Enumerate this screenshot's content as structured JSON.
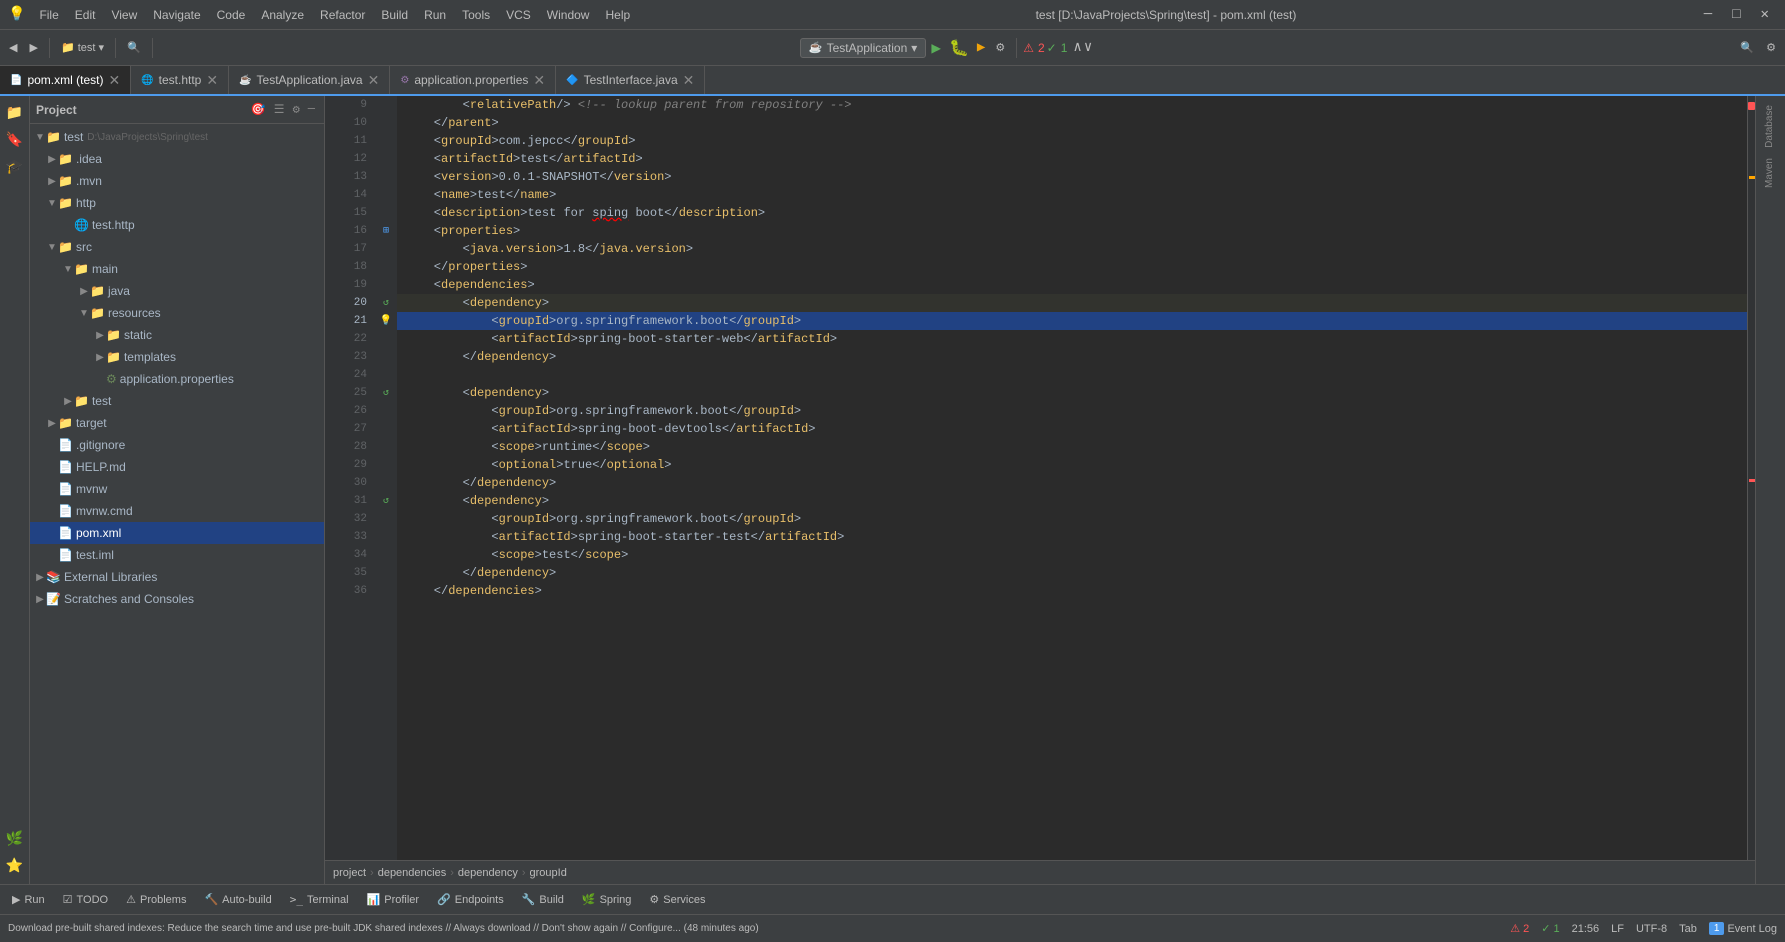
{
  "window": {
    "title": "test [D:\\JavaProjects\\Spring\\test] - pom.xml (test)",
    "app_icon": "💡"
  },
  "menus": [
    "File",
    "Edit",
    "View",
    "Navigate",
    "Code",
    "Analyze",
    "Refactor",
    "Build",
    "Run",
    "Tools",
    "VCS",
    "Window",
    "Help"
  ],
  "project_tab": "Project",
  "run_config": "TestApplication",
  "tabs": [
    {
      "id": "pom-xml",
      "label": "pom.xml (test)",
      "icon": "📄",
      "active": true,
      "closable": true
    },
    {
      "id": "test-http",
      "label": "test.http",
      "icon": "🌐",
      "active": false,
      "closable": true
    },
    {
      "id": "TestApplication",
      "label": "TestApplication.java",
      "icon": "☕",
      "active": false,
      "closable": true
    },
    {
      "id": "app-props",
      "label": "application.properties",
      "icon": "⚙",
      "active": false,
      "closable": true
    },
    {
      "id": "TestInterface",
      "label": "TestInterface.java",
      "icon": "🔷",
      "active": false,
      "closable": true
    }
  ],
  "tree": {
    "root": "test",
    "root_path": "D:\\JavaProjects\\Spring\\test",
    "items": [
      {
        "id": "idea",
        "name": ".idea",
        "type": "folder",
        "indent": 1,
        "expanded": false
      },
      {
        "id": "mvn",
        "name": ".mvn",
        "type": "folder",
        "indent": 1,
        "expanded": false
      },
      {
        "id": "http",
        "name": "http",
        "type": "folder",
        "indent": 1,
        "expanded": true
      },
      {
        "id": "test-http-file",
        "name": "test.http",
        "type": "http",
        "indent": 2,
        "expanded": false
      },
      {
        "id": "src",
        "name": "src",
        "type": "folder",
        "indent": 1,
        "expanded": true
      },
      {
        "id": "main",
        "name": "main",
        "type": "folder",
        "indent": 2,
        "expanded": true
      },
      {
        "id": "java",
        "name": "java",
        "type": "folder",
        "indent": 3,
        "expanded": false
      },
      {
        "id": "resources",
        "name": "resources",
        "type": "folder",
        "indent": 3,
        "expanded": true
      },
      {
        "id": "static",
        "name": "static",
        "type": "folder",
        "indent": 4,
        "expanded": false
      },
      {
        "id": "templates",
        "name": "templates",
        "type": "folder",
        "indent": 4,
        "expanded": false
      },
      {
        "id": "app-props-file",
        "name": "application.properties",
        "type": "props",
        "indent": 4,
        "expanded": false
      },
      {
        "id": "test-folder",
        "name": "test",
        "type": "folder",
        "indent": 2,
        "expanded": false
      },
      {
        "id": "target",
        "name": "target",
        "type": "folder",
        "indent": 1,
        "expanded": false
      },
      {
        "id": "gitignore",
        "name": ".gitignore",
        "type": "file",
        "indent": 1,
        "expanded": false
      },
      {
        "id": "helpmd",
        "name": "HELP.md",
        "type": "file",
        "indent": 1,
        "expanded": false
      },
      {
        "id": "mvnw-file",
        "name": "mvnw",
        "type": "file",
        "indent": 1,
        "expanded": false
      },
      {
        "id": "mvnw-cmd",
        "name": "mvnw.cmd",
        "type": "file",
        "indent": 1,
        "expanded": false
      },
      {
        "id": "pom-xml-file",
        "name": "pom.xml",
        "type": "xml",
        "indent": 1,
        "expanded": false,
        "selected": true
      },
      {
        "id": "test-iml",
        "name": "test.iml",
        "type": "file",
        "indent": 1,
        "expanded": false
      },
      {
        "id": "ext-libs",
        "name": "External Libraries",
        "type": "ext",
        "indent": 0,
        "expanded": false
      },
      {
        "id": "scratches",
        "name": "Scratches and Consoles",
        "type": "scratch",
        "indent": 0,
        "expanded": false
      }
    ]
  },
  "code": {
    "lines": [
      {
        "num": 9,
        "content": "        <relativePath/> <!-- lookup parent from repository -->",
        "type": "normal"
      },
      {
        "num": 10,
        "content": "    </parent>",
        "type": "normal"
      },
      {
        "num": 11,
        "content": "    <groupId>com.jepcc</groupId>",
        "type": "normal"
      },
      {
        "num": 12,
        "content": "    <artifactId>test</artifactId>",
        "type": "normal"
      },
      {
        "num": 13,
        "content": "    <version>0.0.1-SNAPSHOT</version>",
        "type": "normal"
      },
      {
        "num": 14,
        "content": "    <name>test</name>",
        "type": "normal"
      },
      {
        "num": 15,
        "content": "    <description>test for sping boot</description>",
        "type": "normal",
        "has_typo": true
      },
      {
        "num": 16,
        "content": "    <properties>",
        "type": "fold"
      },
      {
        "num": 17,
        "content": "        <java.version>1.8</java.version>",
        "type": "normal"
      },
      {
        "num": 18,
        "content": "    </properties>",
        "type": "normal"
      },
      {
        "num": 19,
        "content": "    <dependencies>",
        "type": "normal"
      },
      {
        "num": 20,
        "content": "        <dependency>",
        "type": "highlight",
        "has_icon": true
      },
      {
        "num": 21,
        "content": "            <groupId>org.springframework.boot</groupId>",
        "type": "normal",
        "has_bulb": true
      },
      {
        "num": 22,
        "content": "            <artifactId>spring-boot-starter-web</artifactId>",
        "type": "normal"
      },
      {
        "num": 23,
        "content": "        </dependency>",
        "type": "normal"
      },
      {
        "num": 24,
        "content": "",
        "type": "normal"
      },
      {
        "num": 25,
        "content": "        <dependency>",
        "type": "normal",
        "has_icon": true
      },
      {
        "num": 26,
        "content": "            <groupId>org.springframework.boot</groupId>",
        "type": "normal"
      },
      {
        "num": 27,
        "content": "            <artifactId>spring-boot-devtools</artifactId>",
        "type": "normal"
      },
      {
        "num": 28,
        "content": "            <scope>runtime</scope>",
        "type": "normal"
      },
      {
        "num": 29,
        "content": "            <optional>true</optional>",
        "type": "normal"
      },
      {
        "num": 30,
        "content": "        </dependency>",
        "type": "normal"
      },
      {
        "num": 31,
        "content": "        <dependency>",
        "type": "normal",
        "has_icon": true
      },
      {
        "num": 32,
        "content": "            <groupId>org.springframework.boot</groupId>",
        "type": "normal"
      },
      {
        "num": 33,
        "content": "            <artifactId>spring-boot-starter-test</artifactId>",
        "type": "normal"
      },
      {
        "num": 34,
        "content": "            <scope>test</scope>",
        "type": "normal"
      },
      {
        "num": 35,
        "content": "        </dependency>",
        "type": "normal"
      },
      {
        "num": 36,
        "content": "    </dependencies>",
        "type": "normal"
      }
    ]
  },
  "breadcrumb": {
    "items": [
      "project",
      "dependencies",
      "dependency",
      "groupId"
    ]
  },
  "status_bar": {
    "message": "Download pre-built shared indexes: Reduce the search time and use pre-built JDK shared indexes // Always download // Don't show again // Configure... (48 minutes ago)",
    "errors": "2",
    "warnings": "1",
    "line_col": "21:56",
    "encoding": "UTF-8",
    "line_sep": "LF",
    "indent": "Tab",
    "event_log": "Event Log",
    "event_count": "1"
  },
  "bottom_tabs": [
    {
      "id": "run",
      "label": "Run",
      "icon": "▶"
    },
    {
      "id": "todo",
      "label": "TODO",
      "icon": "☑"
    },
    {
      "id": "problems",
      "label": "Problems",
      "icon": "⚠"
    },
    {
      "id": "auto-build",
      "label": "Auto-build",
      "icon": "🔨"
    },
    {
      "id": "terminal",
      "label": "Terminal",
      "icon": ">"
    },
    {
      "id": "profiler",
      "label": "Profiler",
      "icon": "📊"
    },
    {
      "id": "endpoints",
      "label": "Endpoints",
      "icon": "🔗"
    },
    {
      "id": "build",
      "label": "Build",
      "icon": "🔨"
    },
    {
      "id": "spring",
      "label": "Spring",
      "icon": "🌿"
    },
    {
      "id": "services",
      "label": "Services",
      "icon": "⚙"
    }
  ],
  "side_icons": {
    "left": [
      "📁",
      "🔍",
      "🔧",
      "🌿",
      "☰"
    ],
    "right": [
      "🗄",
      "🔨"
    ]
  }
}
